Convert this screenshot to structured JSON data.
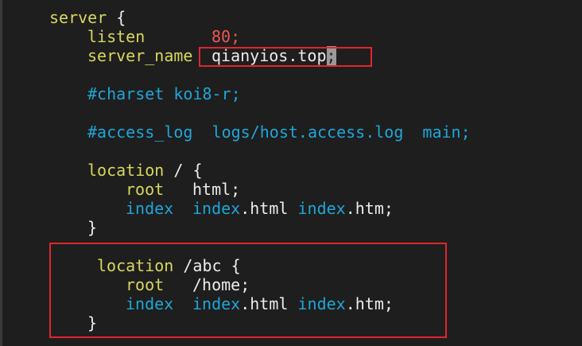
{
  "code": {
    "server_kw": "server",
    "open_brace": "{",
    "listen_kw": "listen",
    "listen_value": "80;",
    "server_name_kw": "server_name",
    "server_name_value": "qianyios.top",
    "server_name_end": ";",
    "charset_comment": "#charset koi8-r;",
    "access_log_comment": "#access_log  logs/host.access.log  main;",
    "location1_kw": "location",
    "location1_path": "/ {",
    "root1_kw": "root",
    "root1_value": "html;",
    "index1_kw": "index",
    "index1_file1": "index",
    "index1_ext1": ".html",
    "index1_file2": "index",
    "index1_ext2": ".htm;",
    "close1": "}",
    "location2_kw": "location",
    "location2_path": "/abc {",
    "root2_kw": "root",
    "root2_value": "/home;",
    "index2_kw": "index",
    "index2_file1": "index",
    "index2_ext1": ".html",
    "index2_file2": "index",
    "index2_ext2": ".htm;",
    "close2": "}"
  },
  "colors": {
    "background": "#1e1e1e",
    "keyword_yellow": "#d7d75f",
    "number_red": "#ee5555",
    "directive_blue": "#1fa6d8",
    "highlight_box": "#e0262d"
  }
}
